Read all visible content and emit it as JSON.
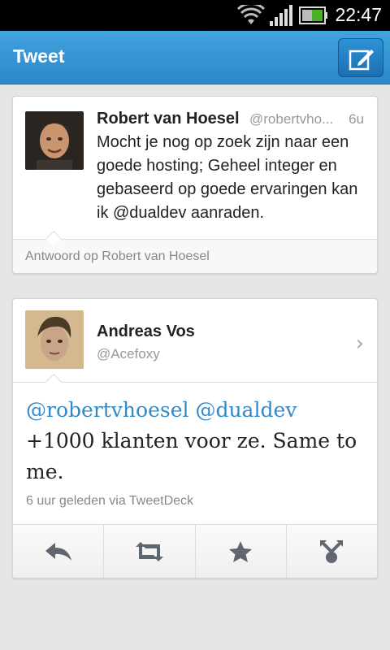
{
  "status_bar": {
    "time": "22:47"
  },
  "action_bar": {
    "title": "Tweet"
  },
  "original_tweet": {
    "author_name": "Robert van Hoesel",
    "author_handle": "@robertvho...",
    "time": "6u",
    "text": "Mocht je nog op zoek zijn naar een goede hosting; Geheel integer en gebaseerd op goede ervaringen kan ik @dualdev aanraden.",
    "reply_context": "Antwoord op Robert van Hoesel"
  },
  "reply_tweet": {
    "author_name": "Andreas Vos",
    "author_handle": "@Acefoxy",
    "mentions": [
      "@robertvhoesel",
      "@dualdev"
    ],
    "text_rest": "+1000 klanten voor ze. Same to me.",
    "meta": "6 uur geleden via TweetDeck"
  },
  "actions": [
    {
      "name": "reply",
      "icon": "reply-icon"
    },
    {
      "name": "retweet",
      "icon": "retweet-icon"
    },
    {
      "name": "favorite",
      "icon": "star-icon"
    },
    {
      "name": "share",
      "icon": "share-icon"
    }
  ],
  "colors": {
    "accent": "#2f8ac7",
    "action_bar": "#3596d4"
  }
}
